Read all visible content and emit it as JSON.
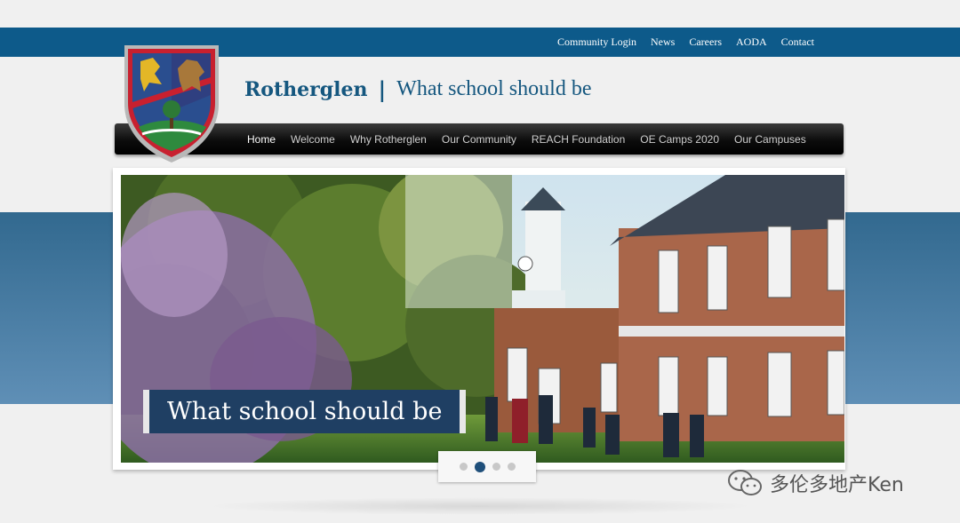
{
  "top_links": [
    "Community Login",
    "News",
    "Careers",
    "AODA",
    "Contact"
  ],
  "brand": {
    "name": "Rotherglen",
    "separator": "|",
    "tagline": "What school should be"
  },
  "nav": {
    "items": [
      "Home",
      "Welcome",
      "Why Rotherglen",
      "Our Community",
      "REACH Foundation",
      "OE Camps 2020",
      "Our Campuses"
    ],
    "active_index": 0
  },
  "slider": {
    "caption": "What school should be",
    "slide_count": 4,
    "active_slide": 1
  },
  "watermark": {
    "text": "多伦多地产Ken",
    "icon": "wechat-icon"
  },
  "colors": {
    "topbar": "#0d5a8a",
    "brand": "#15577f",
    "caption_bg": "#1f3f63",
    "blue_band": "#3d729a"
  }
}
